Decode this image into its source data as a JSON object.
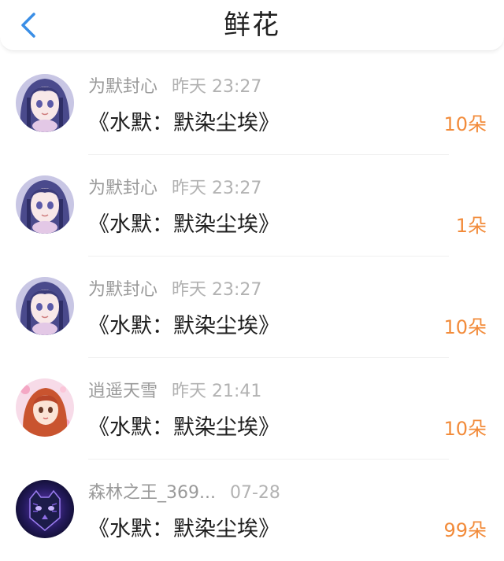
{
  "header": {
    "title": "鲜花",
    "back_icon": "chevron-left-icon",
    "accent_color": "#3a8ee6"
  },
  "rows": [
    {
      "user": "为默封心",
      "time": "昨天 23:27",
      "book": "《水默：默染尘埃》",
      "count": "10朵",
      "avatar": "anime-girl-avatar"
    },
    {
      "user": "为默封心",
      "time": "昨天 23:27",
      "book": "《水默：默染尘埃》",
      "count": "1朵",
      "avatar": "anime-girl-avatar"
    },
    {
      "user": "为默封心",
      "time": "昨天 23:27",
      "book": "《水默：默染尘埃》",
      "count": "10朵",
      "avatar": "anime-girl-avatar"
    },
    {
      "user": "逍遥天雪",
      "time": "昨天 21:41",
      "book": "《水默：默染尘埃》",
      "count": "10朵",
      "avatar": "anime-redhead-avatar"
    },
    {
      "user": "森林之王_369...",
      "time": "07-28",
      "book": "《水默：默染尘埃》",
      "count": "99朵",
      "avatar": "tiger-avatar"
    }
  ],
  "colors": {
    "count": "#f28b3a",
    "meta": "#9a9a9a",
    "book": "#1e1e1e"
  }
}
